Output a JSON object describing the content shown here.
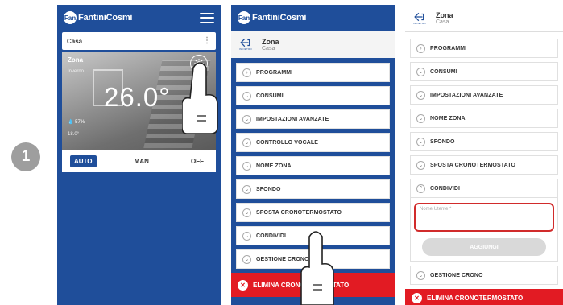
{
  "step_number": "1",
  "colors": {
    "brand_blue": "#1f4e9a",
    "danger_red": "#e21b23",
    "highlight_red": "#d12b2b"
  },
  "screen1": {
    "logo_text": "FantiniCosmi",
    "logo_mark": "Fan",
    "house_label": "Casa",
    "zone_name": "Zona",
    "season": "Inverno",
    "temperature": "26.0°",
    "humidity": "57%",
    "setpoint": "18.0°",
    "modes": [
      "AUTO",
      "MAN",
      "OFF"
    ],
    "active_mode": "AUTO"
  },
  "screen2": {
    "logo_text": "FantiniCosmi",
    "logo_mark": "Fan",
    "header_title": "Zona",
    "header_subtitle": "Casa",
    "back_label": "INDIETRO",
    "items": [
      "PROGRAMMI",
      "CONSUMI",
      "IMPOSTAZIONI AVANZATE",
      "CONTROLLO VOCALE",
      "NOME ZONA",
      "SFONDO",
      "SPOSTA CRONOTERMOSTATO",
      "CONDIVIDI",
      "GESTIONE CRONO"
    ],
    "delete_label": "ELIMINA CRONOTERMOSTATO"
  },
  "screen3": {
    "header_title": "Zona",
    "header_subtitle": "Casa",
    "back_label": "INDIETRO",
    "items_before": [
      "PROGRAMMI",
      "CONSUMI",
      "IMPOSTAZIONI AVANZATE",
      "NOME ZONA",
      "SFONDO",
      "SPOSTA CRONOTERMOSTATO"
    ],
    "share_label": "CONDIVIDI",
    "username_placeholder": "Nome Utente *",
    "add_button": "AGGIUNGI",
    "items_after": [
      "GESTIONE CRONO"
    ],
    "delete_label": "ELIMINA CRONOTERMOSTATO"
  }
}
